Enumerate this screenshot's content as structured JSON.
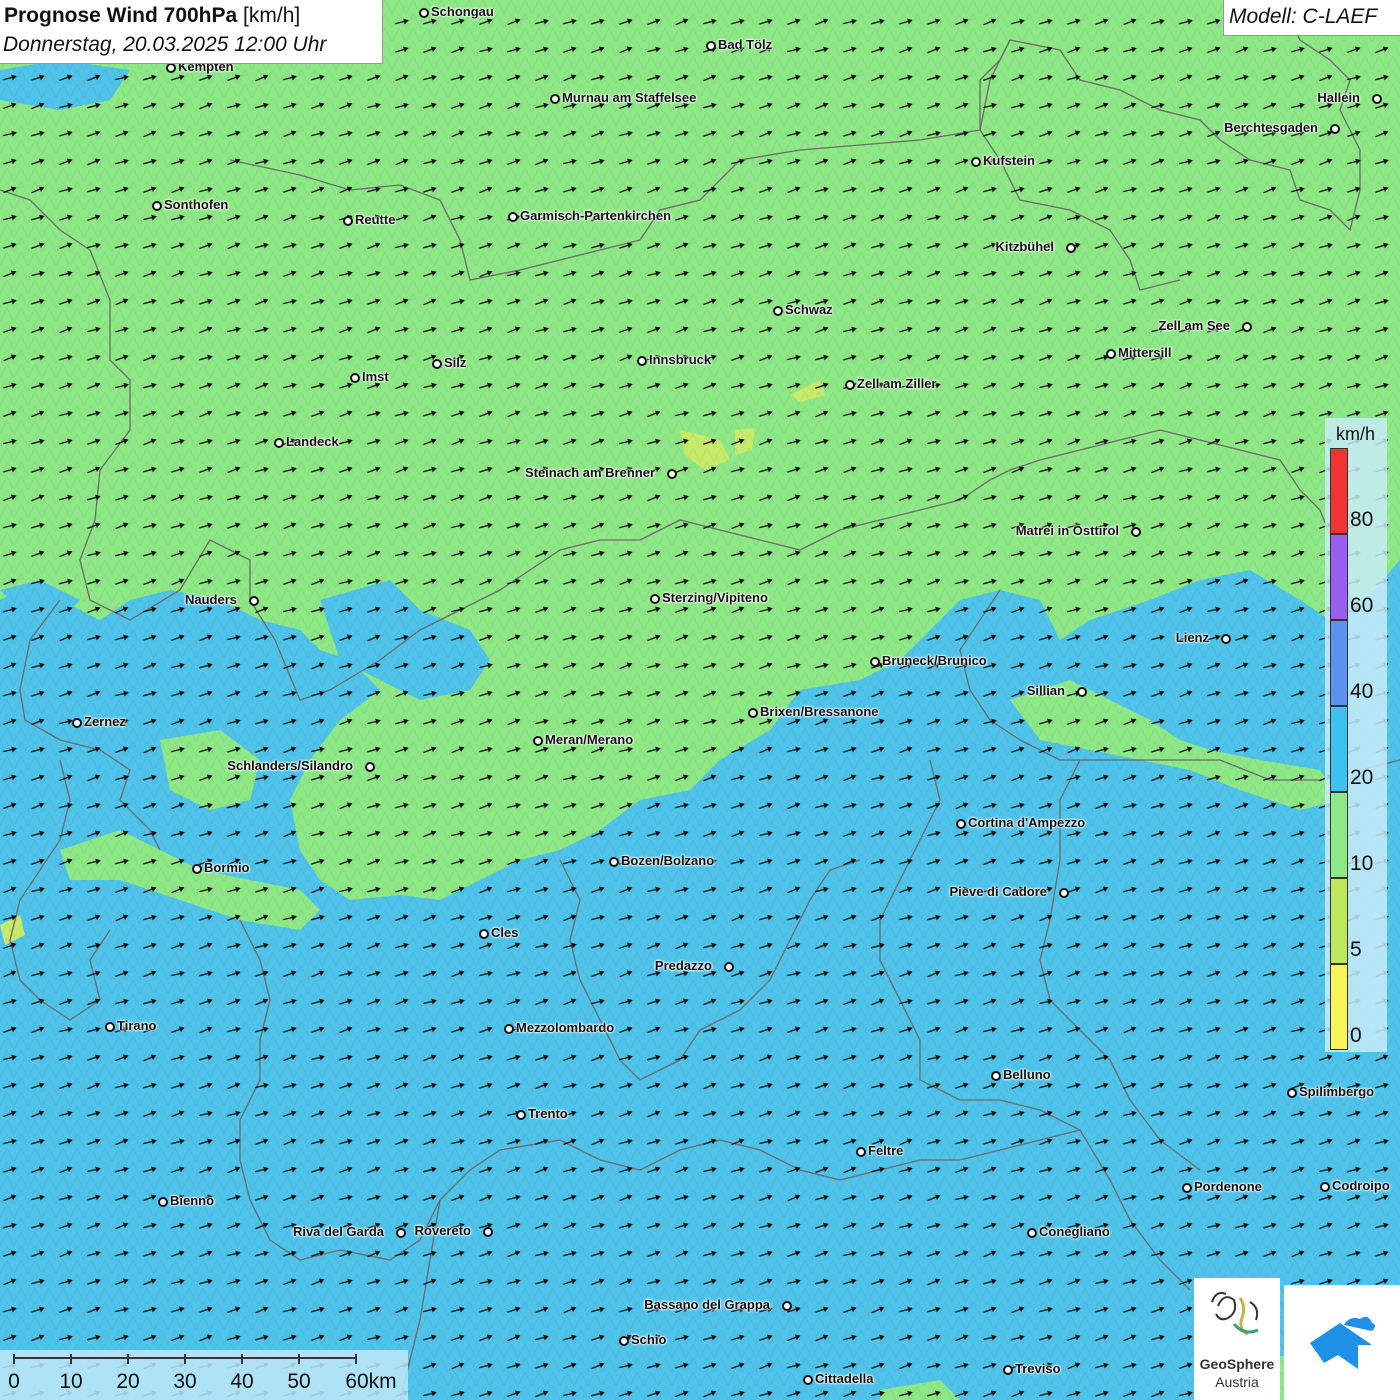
{
  "header": {
    "title_bold": "Prognose Wind 700hPa",
    "title_unit": " [km/h]",
    "datetime": "Donnerstag, 20.03.2025 12:00 Uhr",
    "model": "Modell: C-LAEF"
  },
  "legend": {
    "unit": "km/h",
    "classes": [
      {
        "label": "0",
        "color": "#f7f35a"
      },
      {
        "label": "5",
        "color": "#bde85c"
      },
      {
        "label": "10",
        "color": "#8ee886"
      },
      {
        "label": "20",
        "color": "#3cc2ef"
      },
      {
        "label": "40",
        "color": "#5b93ef"
      },
      {
        "label": "60",
        "color": "#9a5ff0"
      },
      {
        "label": "80",
        "color": "#f03333"
      }
    ]
  },
  "scalebar": {
    "ticks": [
      "0",
      "10",
      "20",
      "30",
      "40",
      "50",
      "60km"
    ]
  },
  "wind": {
    "direction": "from west-southwest",
    "prevailing_class_north": "10",
    "prevailing_class_south": "20"
  },
  "cities": [
    {
      "name": "Schongau",
      "side": "r"
    },
    {
      "name": "Bad Tölz",
      "side": "r"
    },
    {
      "name": "Kempten",
      "side": "r"
    },
    {
      "name": "Murnau am Staffelsee",
      "side": "r"
    },
    {
      "name": "Hallein",
      "side": "l"
    },
    {
      "name": "Berchtesgaden",
      "side": "l"
    },
    {
      "name": "Kufstein",
      "side": "r"
    },
    {
      "name": "Sonthofen",
      "side": "r"
    },
    {
      "name": "Reutte",
      "side": "r"
    },
    {
      "name": "Garmisch-Partenkirchen",
      "side": "r"
    },
    {
      "name": "Kitzbühel",
      "side": "l"
    },
    {
      "name": "Schwaz",
      "side": "r"
    },
    {
      "name": "Zell am See",
      "side": "l"
    },
    {
      "name": "Mittersill",
      "side": "r"
    },
    {
      "name": "Innsbruck",
      "side": "r"
    },
    {
      "name": "Silz",
      "side": "r"
    },
    {
      "name": "Imst",
      "side": "r"
    },
    {
      "name": "Zell am Ziller",
      "side": "r"
    },
    {
      "name": "Landeck",
      "side": "r"
    },
    {
      "name": "Steinach am Brenner",
      "side": "l"
    },
    {
      "name": "Matrei in Osttirol",
      "side": "l"
    },
    {
      "name": "Nauders",
      "side": "l"
    },
    {
      "name": "Sterzing/Vipiteno",
      "side": "r"
    },
    {
      "name": "Lienz",
      "side": "l"
    },
    {
      "name": "Bruneck/Brunico",
      "side": "r"
    },
    {
      "name": "Sillian",
      "side": "l"
    },
    {
      "name": "Zernez",
      "side": "r"
    },
    {
      "name": "Brixen/Bressanone",
      "side": "r"
    },
    {
      "name": "Meran/Merano",
      "side": "r"
    },
    {
      "name": "Schlanders/Silandro",
      "side": "l"
    },
    {
      "name": "Cortina d'Ampezzo",
      "side": "r"
    },
    {
      "name": "Bozen/Bolzano",
      "side": "r"
    },
    {
      "name": "Bormio",
      "side": "r"
    },
    {
      "name": "Pieve di Cadore",
      "side": "l"
    },
    {
      "name": "Cles",
      "side": "r"
    },
    {
      "name": "Predazzo",
      "side": "l"
    },
    {
      "name": "Tirano",
      "side": "r"
    },
    {
      "name": "Mezzolombardo",
      "side": "r"
    },
    {
      "name": "Belluno",
      "side": "r"
    },
    {
      "name": "Spilimbergo",
      "side": "r"
    },
    {
      "name": "Trento",
      "side": "r"
    },
    {
      "name": "Feltre",
      "side": "r"
    },
    {
      "name": "Pordenone",
      "side": "r"
    },
    {
      "name": "Codroipo",
      "side": "r"
    },
    {
      "name": "Bienno",
      "side": "r"
    },
    {
      "name": "Riva del Garda",
      "side": "l"
    },
    {
      "name": "Rovereto",
      "side": "l"
    },
    {
      "name": "Conegliano",
      "side": "r"
    },
    {
      "name": "Bassano del Grappa",
      "side": "l"
    },
    {
      "name": "Schio",
      "side": "r"
    },
    {
      "name": "Treviso",
      "side": "r"
    },
    {
      "name": "Cittadella",
      "side": "r"
    }
  ],
  "logos": {
    "geosphere_line1": "GeoSphere",
    "geosphere_line2": "Austria",
    "second_logo": "cloud-arrow-logo"
  }
}
